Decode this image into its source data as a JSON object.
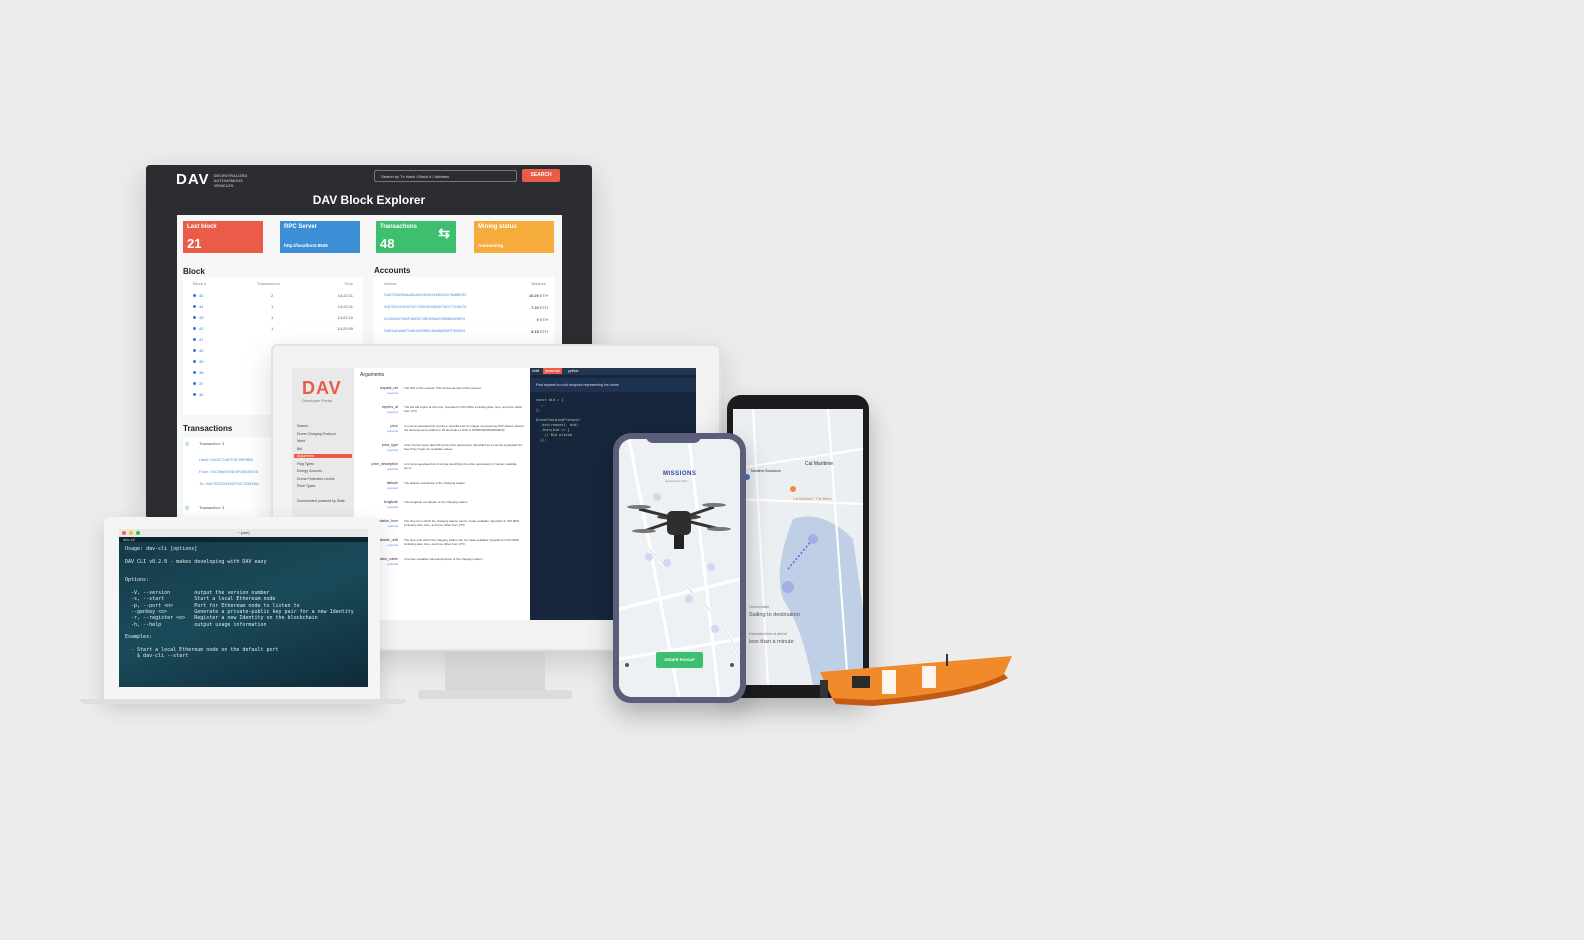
{
  "explorer": {
    "logo": "DAV",
    "tagline": "DECENTRALIZED AUTONOMOUS VEHICLES",
    "search_placeholder": "Search by Tx Hash / Block # / Address",
    "search_button": "SEARCH",
    "title": "DAV Block Explorer",
    "cards": [
      {
        "label": "Last block",
        "value": "21",
        "color": "#ea5b48"
      },
      {
        "label": "RPC Server",
        "value": "http://localhost:8545",
        "color": "#3c8fd4"
      },
      {
        "label": "Transactions",
        "value": "48",
        "color": "#3ebf6f"
      },
      {
        "label": "Mining status",
        "value": "Automining",
        "color": "#f5ac3c"
      }
    ],
    "block_section": "Block",
    "block_headers": [
      "Block #",
      "Transactions",
      "Time"
    ],
    "blocks": [
      {
        "num": "45",
        "tx": "2",
        "time": "14:22:11"
      },
      {
        "num": "44",
        "tx": "1",
        "time": "14:22:11"
      },
      {
        "num": "43",
        "tx": "1",
        "time": "14:22:10"
      },
      {
        "num": "42",
        "tx": "1",
        "time": "14:22:09"
      },
      {
        "num": "41",
        "tx": "",
        "time": ""
      },
      {
        "num": "40",
        "tx": "",
        "time": ""
      },
      {
        "num": "39",
        "tx": "",
        "time": ""
      },
      {
        "num": "38",
        "tx": "",
        "time": ""
      },
      {
        "num": "37",
        "tx": "",
        "time": ""
      },
      {
        "num": "36",
        "tx": "",
        "time": ""
      }
    ],
    "accounts_section": "Accounts",
    "account_headers": [
      "Adress",
      "Balance"
    ],
    "accounts": [
      {
        "addr": "0x627306090abaB3A6e1400e9345bC60c78a8BEf57",
        "bal": "10.20",
        "unit": "ETH"
      },
      {
        "addr": "0xf17f52151EbEF6C7334FAD080c5704D77216b732",
        "bal": "7.20",
        "unit": "ETH"
      },
      {
        "addr": "0xC5fdf4076b8F3A5357c5E395ab970B5B54098Fef",
        "bal": "0",
        "unit": "ETH"
      },
      {
        "addr": "0x821aEa9a577a9b44299B9c15c88cf3087F3b5544",
        "bal": "8.15",
        "unit": "ETH"
      }
    ],
    "tx_section": "Transactions",
    "tx1_label": "Transaction: 3",
    "tx1_hash": "Hash: 0x01C7a87D4F2BF6B1",
    "tx1_from": "From: 0xC5fdf4076b8F3A5357c5",
    "tx1_to": "To: 0xf17f52151EbEF6C7334FAD",
    "tx2_label": "Transaction: 3"
  },
  "portal": {
    "logo": "DAV",
    "subtitle": "Developer Portal",
    "nav": [
      "Search",
      "Drone Charging Protocol",
      "Need",
      "Bid",
      "Arguments",
      "Flag Types",
      "Energy Sources",
      "Drone Protection Levels",
      "Price Types",
      "",
      "Documented powered by Slate"
    ],
    "args_title": "Arguments",
    "args": [
      {
        "name": "request_uid",
        "req": "required",
        "desc": "The UID of the request. This arrives as part of the request"
      },
      {
        "name": "expires_at",
        "req": "required",
        "desc": "The bid will expire at this time. Specified in ISO 8601 including date, time, and time offset from UTC"
      },
      {
        "name": "price",
        "req": "required",
        "desc": "A comma separated list of prices. Specified as an integer representing DAV tokens without the decimal point padded to 18 decimals (1 DAV is 1000000000000000000)"
      },
      {
        "name": "price_type",
        "req": "required",
        "desc": "A list of price types describing the price parameters. Specified as a comma separated list. See Price Types for available values"
      },
      {
        "name": "price_description",
        "req": "required",
        "desc": "A comma separated list of strings describing the price parameters in human readable terms"
      },
      {
        "name": "latitude",
        "req": "required",
        "desc": "The latitude coordinate of the charging station"
      },
      {
        "name": "longitude",
        "req": "required",
        "desc": "The longitude coordinate of the charging station"
      },
      {
        "name": "available_from",
        "req": "optional",
        "desc": "The time from which the charging station can be made available. Specified in ISO 8601 including date, time, and time offset from UTC"
      },
      {
        "name": "available_until",
        "req": "optional",
        "desc": "The time until which the charging station can be made available. Specified in ISO 8601 including date, time, and time offset from UTC"
      },
      {
        "name": "location_name",
        "req": "optional",
        "desc": "A human readable name/description of the charging station"
      }
    ],
    "code_tabs": [
      "shell",
      "javascript",
      "python"
    ],
    "code_note": "Post request to a bid endpoint representing the drone",
    "code": "const bid = {\n  ...\n};\n\nDroneChargingProtocol\n  .bid(request, bid)\n  .then(bid => {\n    // Bid placed\n  });"
  },
  "terminal": {
    "window_title": "~ (zsh)",
    "prompt": "dav-cli",
    "body": "Usage: dav-cli [options]\n\nDAV CLI v0.2.0 - makes developing with DAV easy\n\n\nOptions:\n\n  -V, --version        output the version number\n  -s, --start          Start a local Ethereum node\n  -p, --port <n>       Port for Ethereum node to listen to\n  --genkey <o>         Generate a private-public key pair for a new Identity\n  -r, --register <o>   Register a new Identity on the blockchain\n  -h, --help           output usage information\n\nExamples:\n\n  - Start a local Ethereum node on the default port\n    $ dav-cli --start"
  },
  "iphone": {
    "brand": "MISSIONS",
    "brand_sub": "powered by DAV",
    "order_button": "ORDER PICKUP"
  },
  "android": {
    "place1": "Cal Maritime",
    "place2": "Maritime Bookstore",
    "place3": "Cal Maritime · The Bistro",
    "state_label": "Current state",
    "state_value": "Sailing to destination",
    "eta_label": "Estimated time of arrival",
    "eta_value": "less than a minute"
  }
}
